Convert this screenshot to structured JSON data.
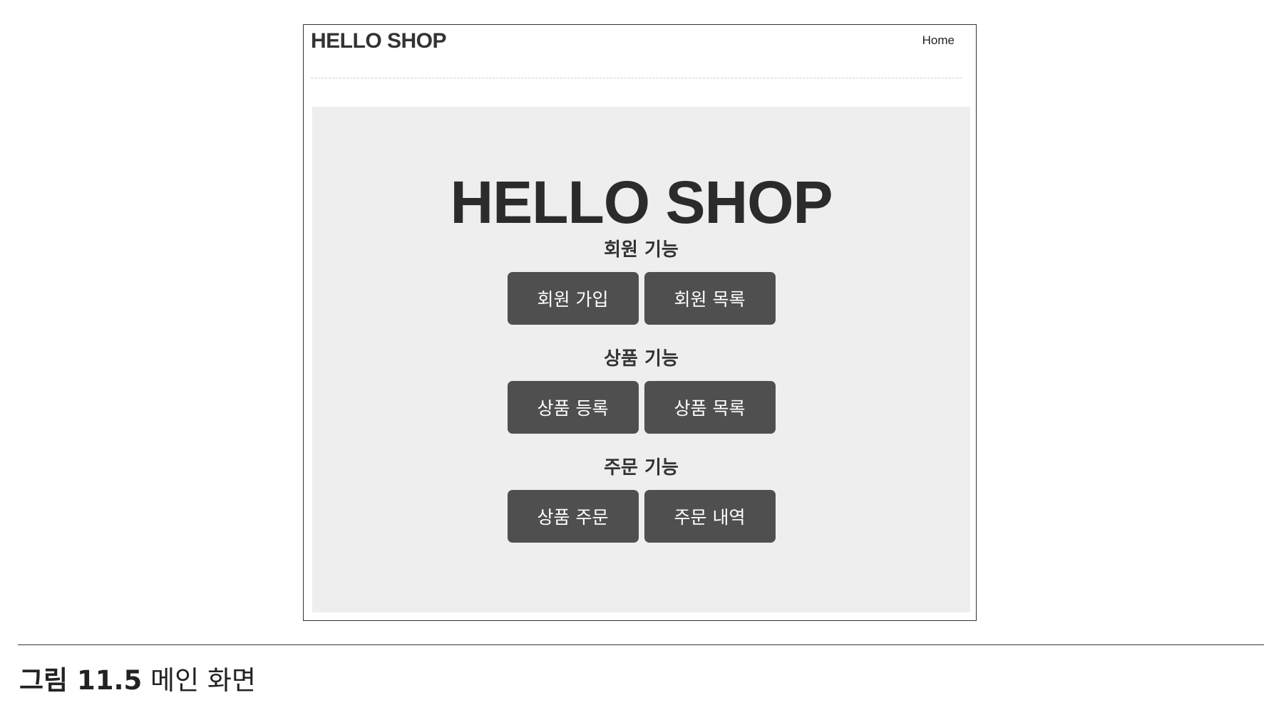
{
  "navbar": {
    "brand": "HELLO SHOP",
    "home_link": "Home"
  },
  "hero": {
    "title": "HELLO SHOP"
  },
  "sections": [
    {
      "label": "회원 기능",
      "buttons": [
        "회원 가입",
        "회원 목록"
      ]
    },
    {
      "label": "상품 기능",
      "buttons": [
        "상품 등록",
        "상품 목록"
      ]
    },
    {
      "label": "주문 기능",
      "buttons": [
        "상품 주문",
        "주문 내역"
      ]
    }
  ],
  "caption": {
    "figure_number": "그림 11.5",
    "text": "메인 화면"
  },
  "colors": {
    "button_bg": "#4f4f4f",
    "jumbotron_bg": "#eeeeee"
  }
}
